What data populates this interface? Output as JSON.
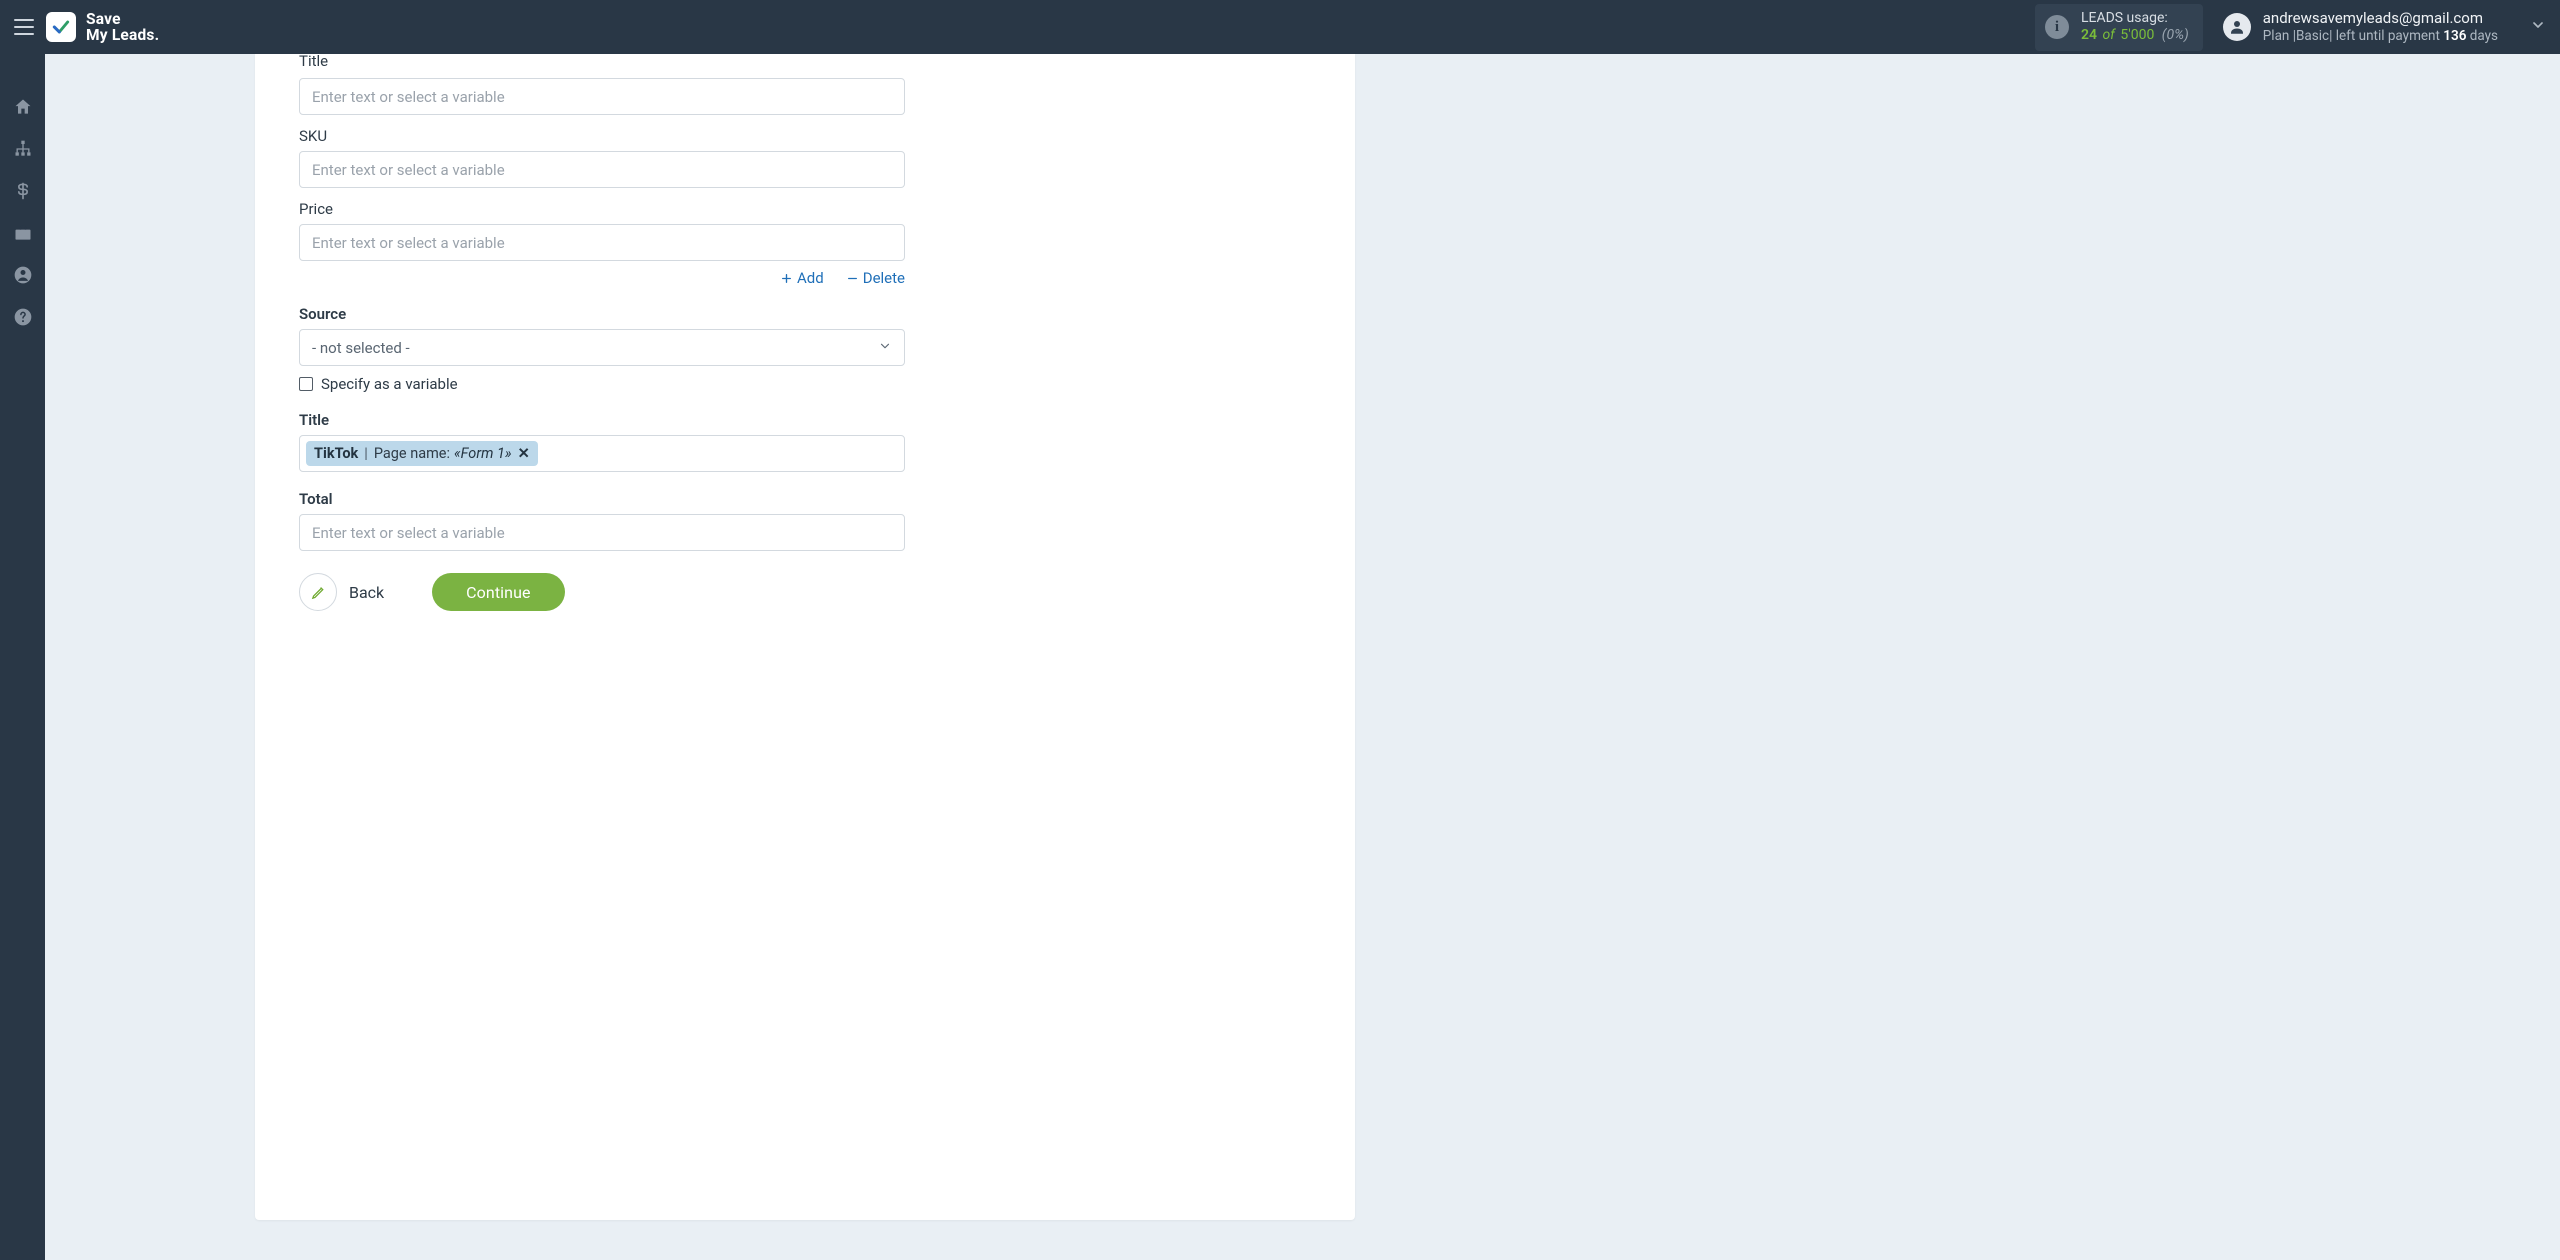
{
  "header": {
    "logo_line1": "Save",
    "logo_line2": "My Leads.",
    "usage": {
      "label": "LEADS usage:",
      "used": "24",
      "of": "of",
      "total": "5'000",
      "pct": "(0%)"
    },
    "account": {
      "email": "andrewsavemyleads@gmail.com",
      "plan_prefix": "Plan |Basic| left until payment ",
      "days_num": "136",
      "days_suffix": " days"
    }
  },
  "form": {
    "placeholder": "Enter text or select a variable",
    "title_label": "Title",
    "sku_label": "SKU",
    "price_label": "Price",
    "add_label": "Add",
    "delete_label": "Delete",
    "source_label": "Source",
    "source_not_selected": "- not selected -",
    "specify_label": "Specify as a variable",
    "title2_label": "Title",
    "tag": {
      "source": "TikTok",
      "sep": " | ",
      "key": "Page name: ",
      "value": "«Form 1»",
      "close": "✕"
    },
    "total_label": "Total",
    "back_label": "Back",
    "continue_label": "Continue"
  }
}
